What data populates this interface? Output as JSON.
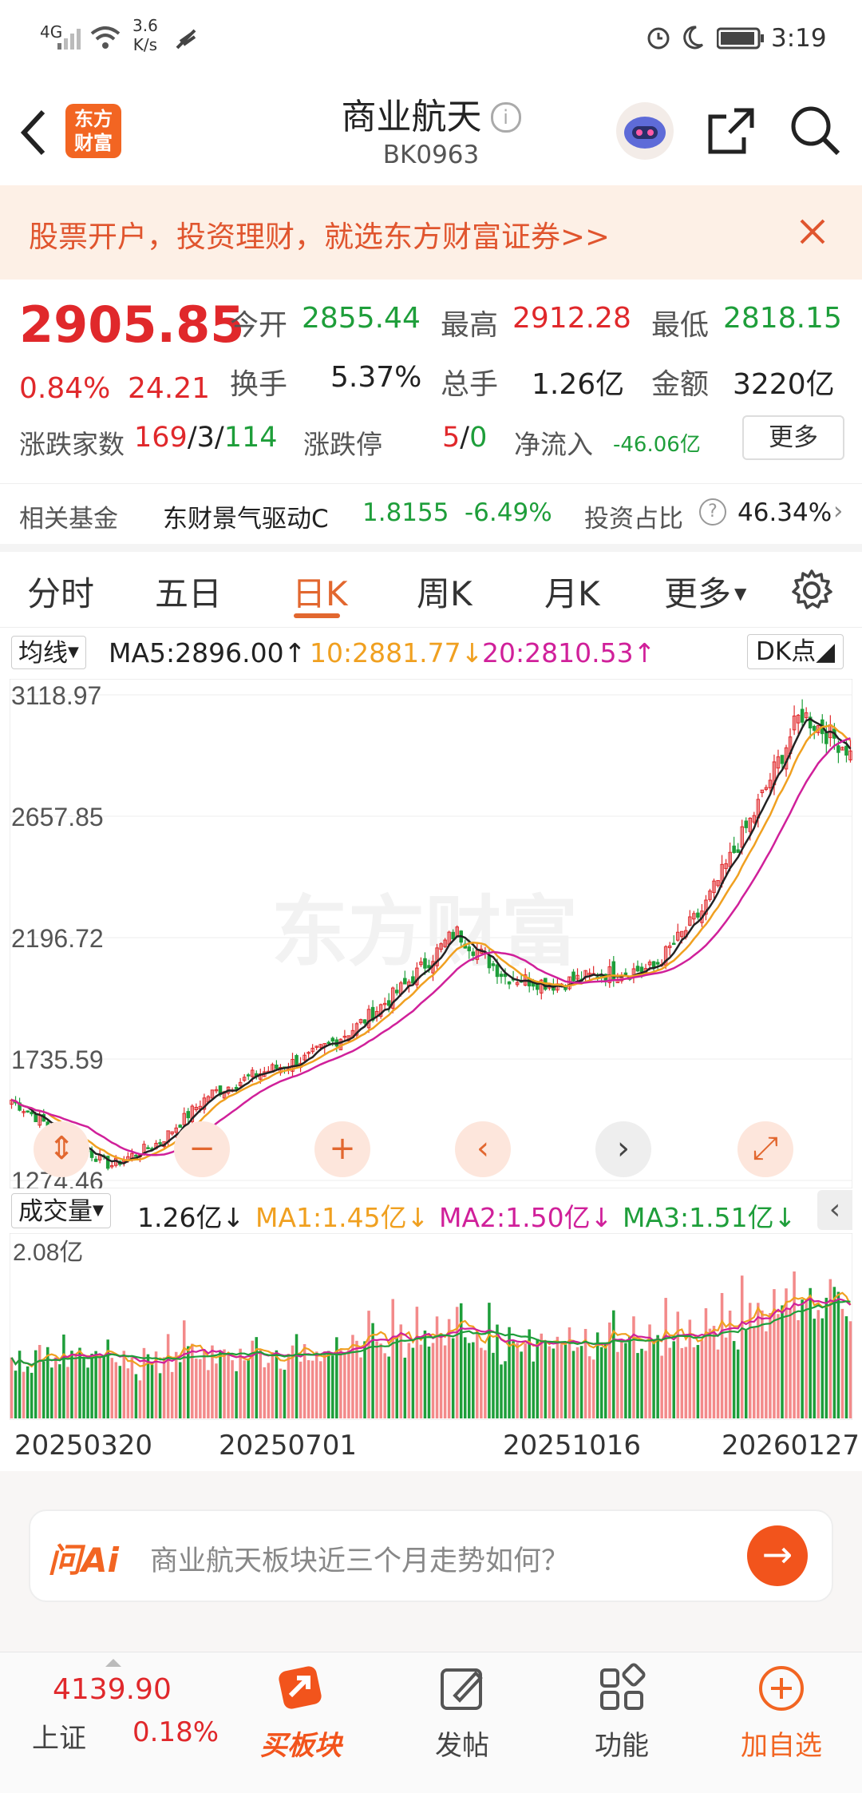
{
  "status_bar": {
    "network": "4G",
    "speed_value": "3.6",
    "speed_unit": "K/s",
    "time": "3:19"
  },
  "nav": {
    "title": "商业航天",
    "code": "BK0963",
    "logo_line1": "东方",
    "logo_line2": "财富"
  },
  "banner": {
    "text": "股票开户，投资理财，就选东方财富证券>>"
  },
  "quote": {
    "price": "2905.85",
    "change_pct": "0.84%",
    "change_abs": "24.21",
    "open_label": "今开",
    "open": "2855.44",
    "high_label": "最高",
    "high": "2912.28",
    "low_label": "最低",
    "low": "2818.15",
    "turnover_label": "换手",
    "turnover": "5.37%",
    "volume_label": "总手",
    "volume": "1.26亿",
    "amount_label": "金额",
    "amount": "3220亿",
    "breadth_label": "涨跌家数",
    "up": "169",
    "flat": "3",
    "down": "114",
    "limit_label": "涨跌停",
    "limit_up": "5",
    "limit_down": "0",
    "netflow_label": "净流入",
    "netflow": "-46.06亿",
    "more_label": "更多"
  },
  "fund": {
    "label": "相关基金",
    "name": "东财景气驱动C",
    "nav": "1.8155",
    "change": "-6.49%",
    "ratio_label": "投资占比",
    "ratio": "46.34%"
  },
  "tabs": [
    "分时",
    "五日",
    "日K",
    "周K",
    "月K",
    "更多"
  ],
  "active_tab": 2,
  "ma_legend": {
    "selector": "均线",
    "ma5": "MA5:2896.00",
    "ma10": "10:2881.77",
    "ma20": "20:2810.53",
    "dk": "DK点"
  },
  "chart_data": {
    "type": "candlestick",
    "y_ticks": [
      "3118.97",
      "2657.85",
      "2196.72",
      "1735.59",
      "1274.46"
    ],
    "ylim": [
      1274.46,
      3118.97
    ],
    "x_ticks": [
      "20250320",
      "20250701",
      "20251016",
      "20260127"
    ],
    "watermark": "东方财富",
    "close_path": [
      [
        "20250320",
        1580
      ],
      [
        "20250401",
        1450
      ],
      [
        "20250415",
        1330
      ],
      [
        "20250501",
        1420
      ],
      [
        "20250520",
        1600
      ],
      [
        "20250610",
        1680
      ],
      [
        "20250701",
        1740
      ],
      [
        "20250801",
        1860
      ],
      [
        "20250901",
        2020
      ],
      [
        "20250920",
        2220
      ],
      [
        "20251001",
        2050
      ],
      [
        "20251016",
        2020
      ],
      [
        "20251101",
        2060
      ],
      [
        "20251201",
        2080
      ],
      [
        "20251220",
        2300
      ],
      [
        "20260110",
        2650
      ],
      [
        "20260127",
        3050
      ],
      [
        "20260205",
        2905.85
      ]
    ],
    "volume": {
      "y_max_label": "2.08亿",
      "current": "1.26亿",
      "ma1": "MA1:1.45亿",
      "ma2": "MA2:1.50亿",
      "ma3": "MA3:1.51亿",
      "selector": "成交量"
    }
  },
  "ai_bar": {
    "brand": "问Ai",
    "placeholder": "商业航天板块近三个月走势如何？"
  },
  "footer": {
    "index_value": "4139.90",
    "index_name": "上证",
    "index_change": "0.18%",
    "buy": "买板块",
    "post": "发帖",
    "func": "功能",
    "add": "加自选"
  },
  "colors": {
    "up": "#e0282b",
    "down": "#1e9e3a",
    "accent": "#f26522",
    "ma5": "#222222",
    "ma10": "#f0a020",
    "ma20": "#d0209a"
  }
}
